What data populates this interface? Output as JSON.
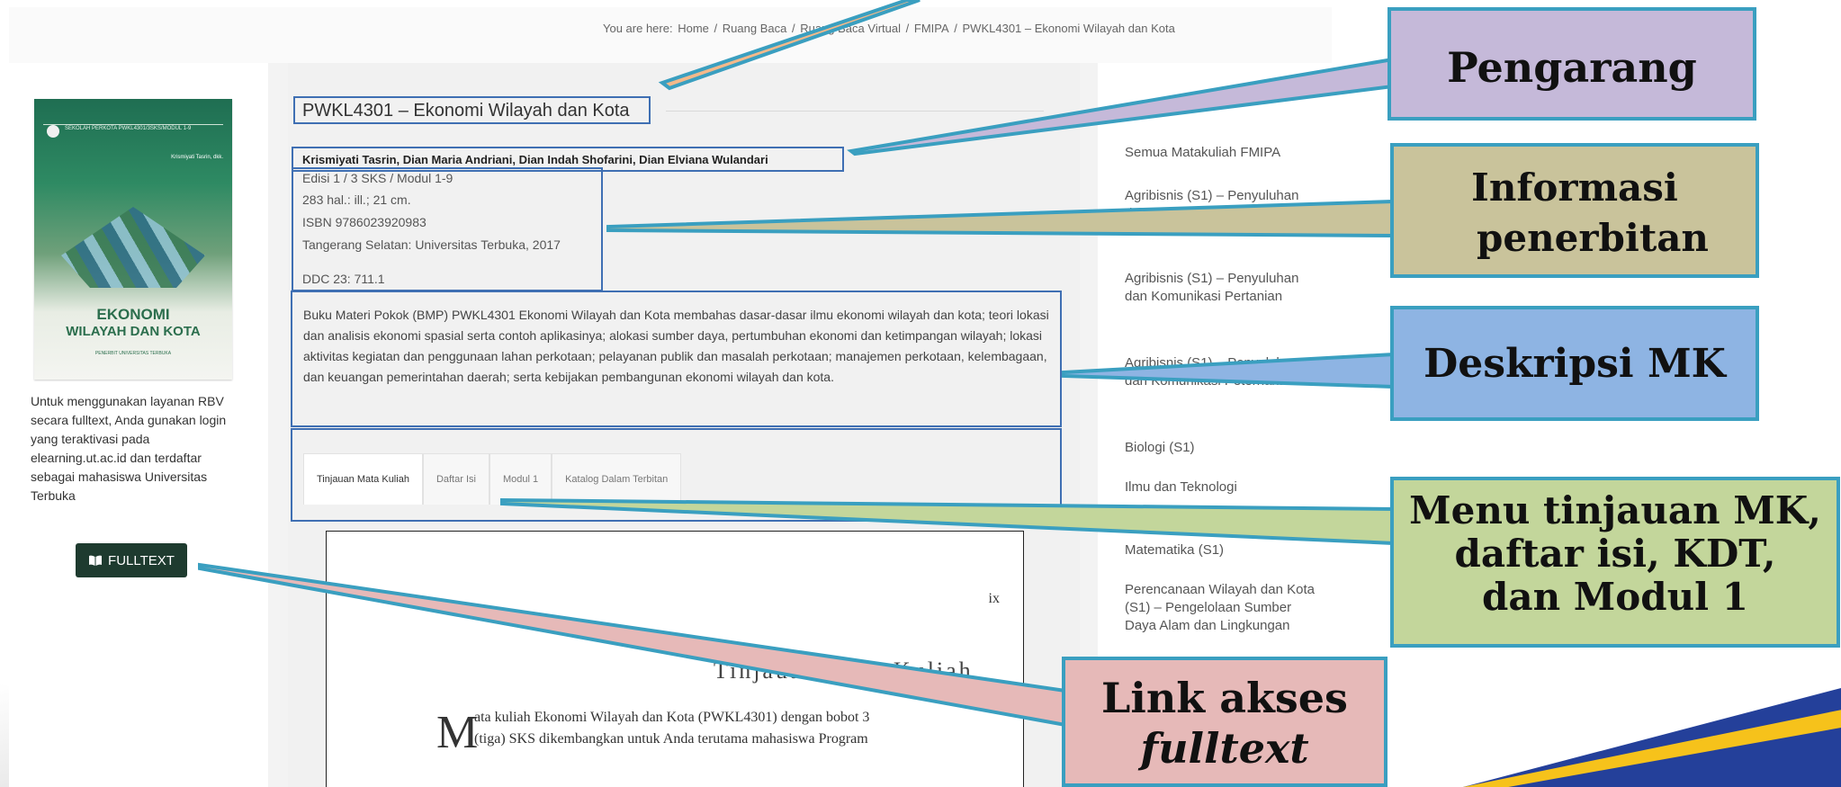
{
  "breadcrumb": {
    "prefix": "You are here:",
    "items": [
      "Home",
      "/",
      "Ruang Baca",
      "/",
      "Ruang Baca Virtual",
      "/",
      "FMIPA",
      "/",
      "PWKL4301 – Ekonomi Wilayah dan Kota"
    ]
  },
  "cover": {
    "small_text": "SEKOLAH PERKOTA PWKL4301/3SKS/MODUL 1-9",
    "authors": "Krismiyati Tasrin, dkk.",
    "title_line1": "EKONOMI",
    "title_line2": "WILAYAH DAN KOTA",
    "publisher": "PENERBIT UNIVERSITAS TERBUKA"
  },
  "left": {
    "info_text": "Untuk menggunakan layanan RBV secara fulltext, Anda gunakan login yang teraktivasi pada elearning.ut.ac.id dan terdaftar sebagai mahasiswa Universitas Terbuka",
    "fulltext_button": "FULLTEXT",
    "fulltext_icon": "book-open-icon"
  },
  "main": {
    "title": "PWKL4301 – Ekonomi Wilayah dan Kota",
    "authors": "Krismiyati Tasrin, Dian Maria Andriani, Dian Indah Shofarini, Dian Elviana Wulandari",
    "publication": {
      "edition": "Edisi 1 / 3 SKS / Modul 1-9",
      "pages": "283 hal.: ill.; 21 cm.",
      "isbn": "ISBN 9786023920983",
      "publisher": "Tangerang Selatan: Universitas Terbuka, 2017",
      "ddc": "DDC 23: 711.1"
    },
    "description": "Buku Materi Pokok (BMP) PWKL4301 Ekonomi Wilayah dan Kota membahas dasar-dasar ilmu ekonomi wilayah dan kota; teori lokasi dan analisis ekonomi spasial serta contoh aplikasinya; alokasi sumber daya, pertumbuhan ekonomi dan ketimpangan wilayah; lokasi aktivitas kegiatan dan penggunaan lahan perkotaan; pelayanan publik dan masalah perkotaan; manajemen perkotaan, kelembagaan, dan keuangan pemerintahan daerah; serta kebijakan pembangunan ekonomi wilayah dan kota.",
    "tabs": [
      "Tinjauan Mata Kuliah",
      "Daftar Isi",
      "Modul 1",
      "Katalog Dalam Terbitan"
    ],
    "document": {
      "page_number": "ix",
      "heading": "Tinjauan Mata Kuliah",
      "dropcap": "M",
      "line1": "ata kuliah Ekonomi Wilayah dan Kota  (PWKL4301) dengan bobot 3",
      "line2": "(tiga) SKS dikembangkan untuk Anda terutama mahasiswa Program"
    }
  },
  "sidebar": {
    "items": [
      "Semua Matakuliah FMIPA",
      "Agribisnis (S1) – Penyuluhan dan",
      "Agribisnis (S1) – Penyuluhan dan Komunikasi Pertanian",
      "Agribisnis (S1) – Penyuluhan dan Komunikasi Peternakan",
      "Biologi (S1)",
      "Ilmu dan Teknologi",
      "Matematika (S1)",
      "Perencanaan Wilayah dan Kota (S1) – Pengelolaan Sumber Daya Alam dan Lingkungan"
    ]
  },
  "callouts": {
    "pengarang": "Pengarang",
    "informasi_line1": "Informasi",
    "informasi_line2": "penerbitan",
    "deskripsi": "Deskripsi MK",
    "menu_line1": "Menu tinjauan MK,",
    "menu_line2": "daftar isi, KDT,",
    "menu_line3": "dan Modul 1",
    "link_line1": "Link akses",
    "link_line2": "fulltext"
  },
  "colors": {
    "highlight_border": "#3f6fb3",
    "callout_border": "#3a9fc0",
    "button_bg": "#1e3b2f",
    "pengarang_bg": "#c5b9d9",
    "informasi_bg": "#c9c39b",
    "deskripsi_bg": "#8eb4e3",
    "menu_bg": "#c3d69b",
    "link_bg": "#e6b9b8"
  }
}
